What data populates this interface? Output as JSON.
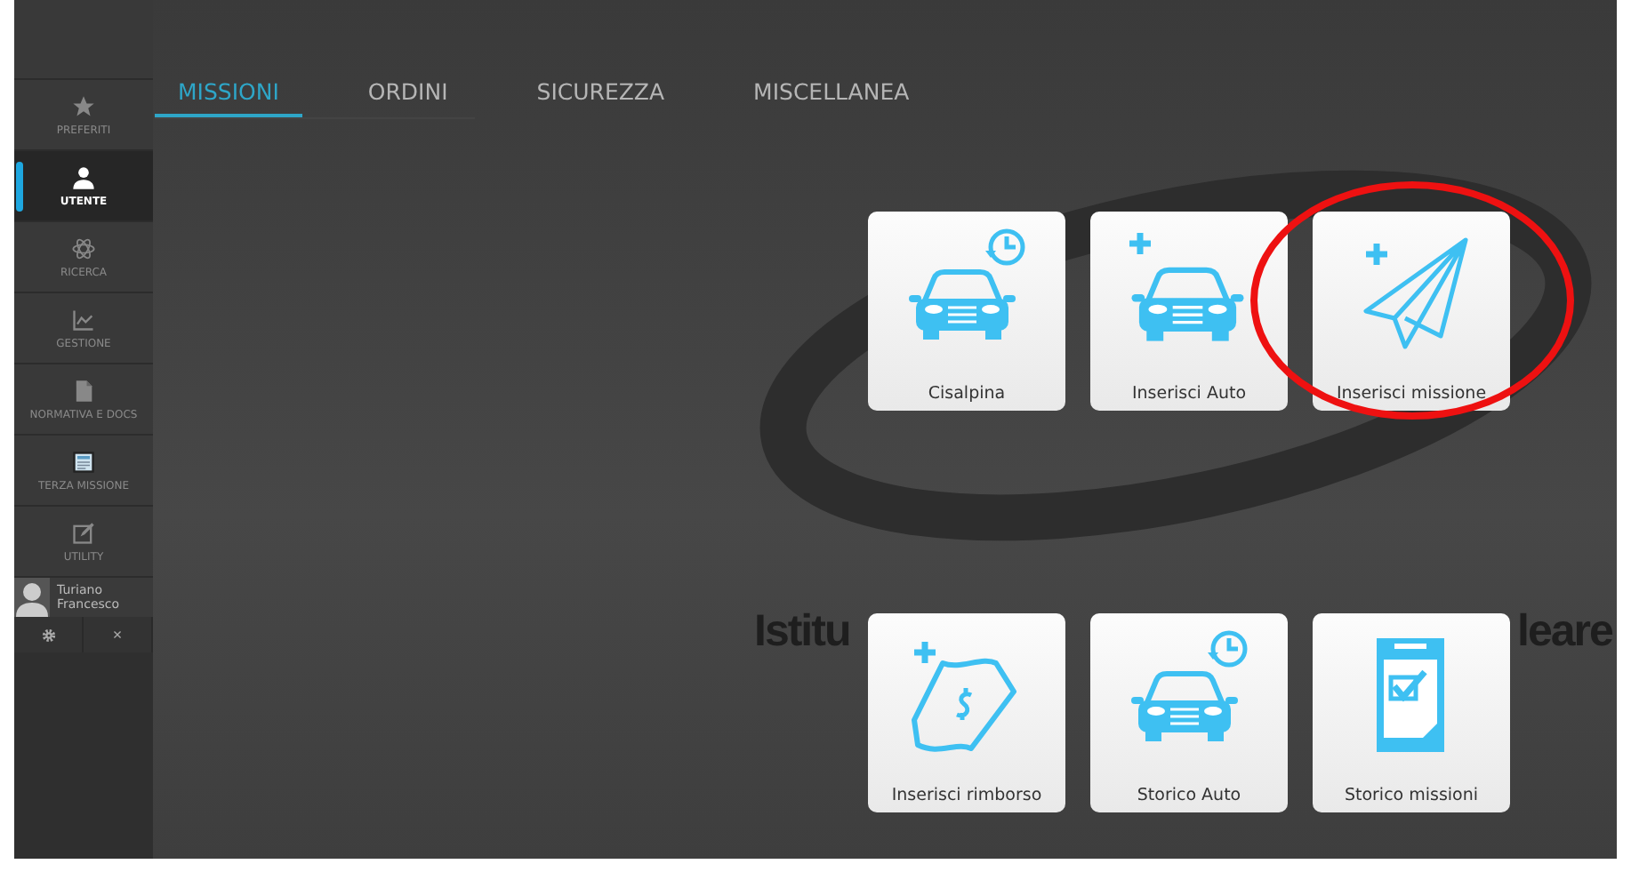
{
  "sidebar": {
    "items": [
      {
        "label": "PREFERITI",
        "selected": false
      },
      {
        "label": "UTENTE",
        "selected": true
      },
      {
        "label": "RICERCA",
        "selected": false
      },
      {
        "label": "GESTIONE",
        "selected": false
      },
      {
        "label": "NORMATIVA E DOCS",
        "selected": false
      },
      {
        "label": "TERZA MISSIONE",
        "selected": false
      },
      {
        "label": "UTILITY",
        "selected": false
      }
    ],
    "user": {
      "first": "Turiano",
      "last": "Francesco"
    },
    "footer": {
      "close": "×"
    }
  },
  "tabs": [
    {
      "label": "MISSIONI",
      "selected": true
    },
    {
      "label": "ORDINI",
      "selected": false
    },
    {
      "label": "SICUREZZA",
      "selected": false
    },
    {
      "label": "MISCELLANEA",
      "selected": false
    }
  ],
  "background_logo": {
    "subtitle": [
      "Istitu",
      "leare"
    ]
  },
  "tiles": [
    {
      "label": "Cisalpina",
      "highlighted": false
    },
    {
      "label": "Inserisci Auto",
      "highlighted": false
    },
    {
      "label": "Inserisci missione",
      "highlighted": true
    },
    {
      "label": "Inserisci rimborso",
      "highlighted": false
    },
    {
      "label": "Storico Auto",
      "highlighted": false
    },
    {
      "label": "Storico missioni",
      "highlighted": false
    }
  ]
}
